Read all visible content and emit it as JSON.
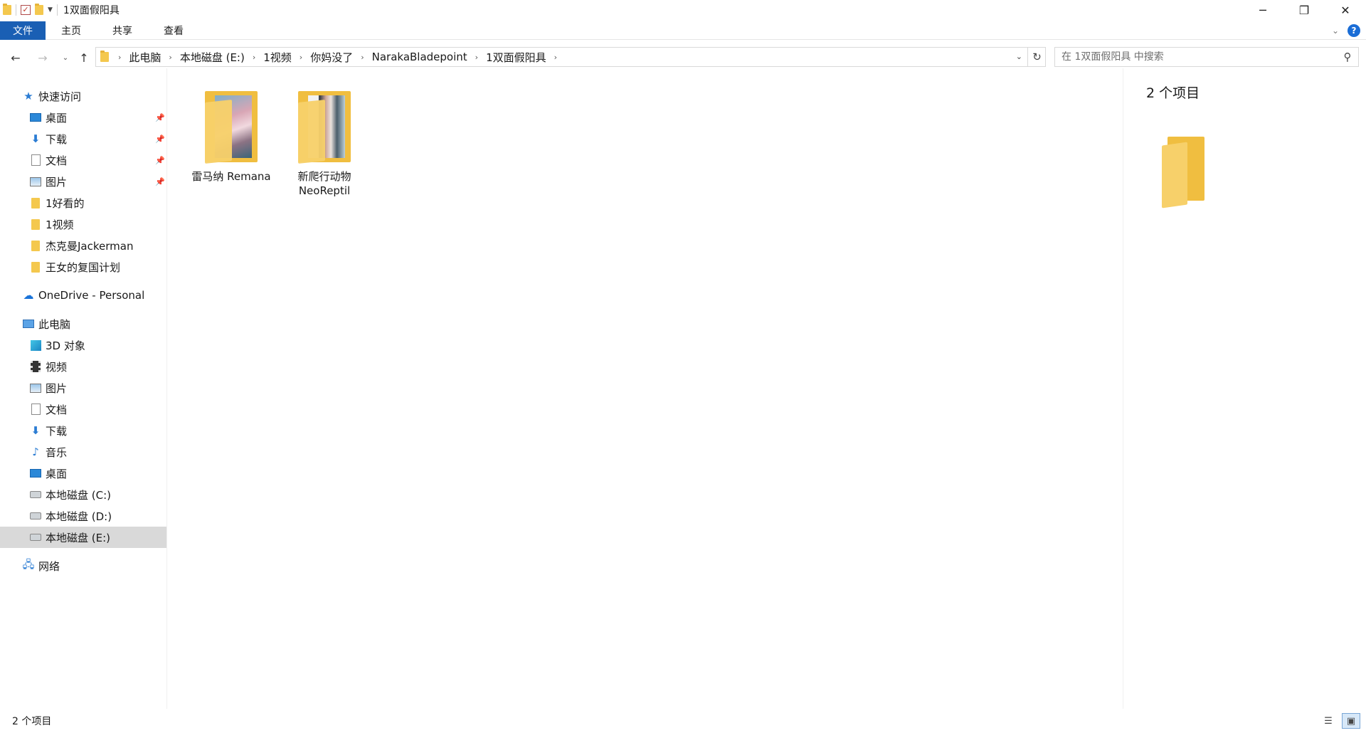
{
  "window": {
    "title": "1双面假阳具",
    "minimize": "─",
    "maximize": "❐",
    "close": "✕"
  },
  "ribbon": {
    "tabs": [
      "文件",
      "主页",
      "共享",
      "查看"
    ],
    "expand": "⌄",
    "help": "?"
  },
  "nav": {
    "back": "←",
    "forward": "→",
    "recent": "⌄",
    "up": "↑",
    "refresh": "↻"
  },
  "address": {
    "crumbs": [
      "此电脑",
      "本地磁盘 (E:)",
      "1视频",
      "你妈没了",
      "NarakaBladepoint",
      "1双面假阳具"
    ],
    "separator": "›"
  },
  "search": {
    "placeholder": "在 1双面假阳具 中搜索"
  },
  "sidebar": {
    "quick_access": "快速访问",
    "quick_items": [
      "桌面",
      "下载",
      "文档",
      "图片",
      "1好看的",
      "1视频",
      "杰克曼Jackerman",
      "王女的复国计划"
    ],
    "onedrive": "OneDrive - Personal",
    "this_pc": "此电脑",
    "pc_items": [
      "3D 对象",
      "视频",
      "图片",
      "文档",
      "下载",
      "音乐",
      "桌面",
      "本地磁盘 (C:)",
      "本地磁盘 (D:)",
      "本地磁盘 (E:)"
    ],
    "network": "网络"
  },
  "content": {
    "items": [
      {
        "name": "雷马纳 Remana"
      },
      {
        "name": "新爬行动物 NeoReptil"
      }
    ]
  },
  "preview": {
    "count": "2 个项目"
  },
  "status": {
    "count": "2 个项目"
  },
  "colors": {
    "accent": "#1a5fb4",
    "folder": "#f4c84e",
    "selected": "#d9d9d9"
  }
}
